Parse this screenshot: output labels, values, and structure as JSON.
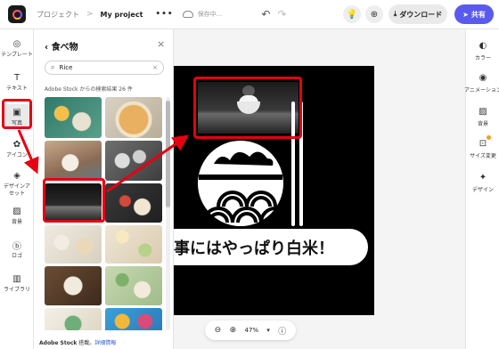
{
  "header": {
    "breadcrumb_root": "プロジェクト",
    "breadcrumb_sep": ">",
    "project_name": "My project",
    "more": "•••",
    "save_status": "保存中...",
    "undo": "↶",
    "redo": "↷",
    "download_label": "ダウンロード",
    "share_label": "共有"
  },
  "left_rail": {
    "items": [
      {
        "label": "テンプレート",
        "icon": "template-icon",
        "glyph": "◎"
      },
      {
        "label": "テキスト",
        "icon": "text-icon",
        "glyph": "T"
      },
      {
        "label": "写真",
        "icon": "photo-icon",
        "glyph": "▣"
      },
      {
        "label": "アイコン",
        "icon": "icon-icon",
        "glyph": "✿"
      },
      {
        "label": "デザインアセット",
        "icon": "design-assets-icon",
        "glyph": "◈"
      },
      {
        "label": "背景",
        "icon": "background-icon",
        "glyph": "▨"
      },
      {
        "label": "ロゴ",
        "icon": "logo-icon",
        "glyph": "ⓑ"
      },
      {
        "label": "ライブラリ",
        "icon": "library-icon",
        "glyph": "▥"
      }
    ]
  },
  "panel": {
    "title": "食べ物",
    "back": "‹",
    "close": "×",
    "search_value": "Rice",
    "search_clear": "×",
    "result_count": "Adobe Stock からの検索結果 26 件",
    "footer_strong": "Adobe Stock",
    "footer_text": " 搭載。",
    "footer_link": "詳細情報"
  },
  "canvas": {
    "banner_text": "事にはやっぱり白米！",
    "zoom_value": "47%"
  },
  "right_rail": {
    "items": [
      {
        "label": "カラー",
        "icon": "color-icon",
        "glyph": "◐"
      },
      {
        "label": "アニメーション",
        "icon": "animation-icon",
        "glyph": "◉"
      },
      {
        "label": "背景",
        "icon": "background-icon",
        "glyph": "▨"
      },
      {
        "label": "サイズ変更",
        "icon": "resize-icon",
        "glyph": "⊡"
      },
      {
        "label": "デザイン",
        "icon": "design-icon",
        "glyph": "✦"
      }
    ]
  },
  "colors": {
    "accent": "#5a5af0",
    "annotation": "#e60012"
  }
}
